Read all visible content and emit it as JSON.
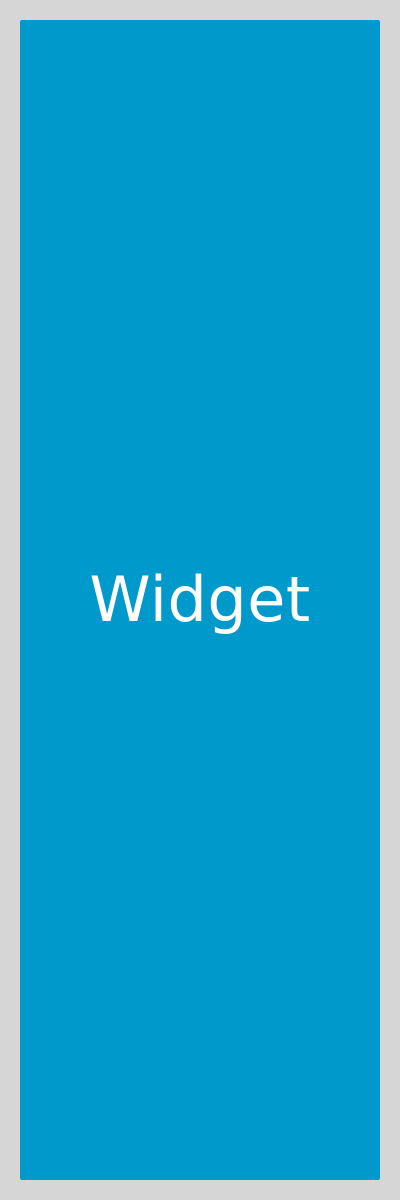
{
  "widget": {
    "label": "Widget",
    "colors": {
      "background": "#0099cc",
      "text": "#ffffff",
      "page_background": "#d6d6d6"
    }
  }
}
